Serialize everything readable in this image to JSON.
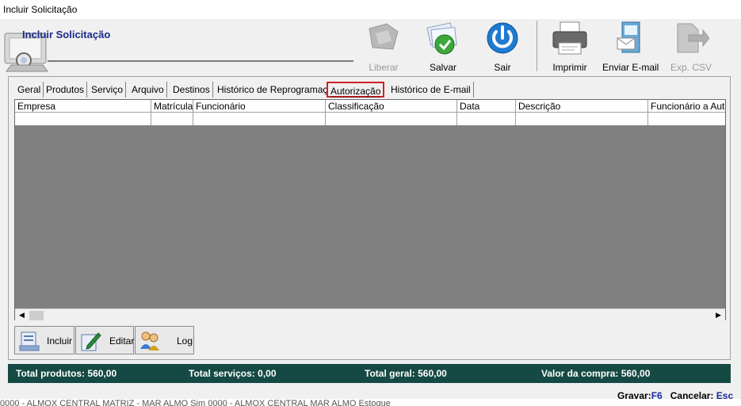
{
  "window": {
    "title": "Incluir Solicitação"
  },
  "header": {
    "title": "Incluir Solicitação"
  },
  "toolbar": {
    "liberar": "Liberar",
    "salvar": "Salvar",
    "sair": "Sair",
    "imprimir": "Imprimir",
    "enviar_email": "Enviar E-mail",
    "exp_csv": "Exp. CSV"
  },
  "tabs": [
    "Geral",
    "Produtos",
    "Serviço",
    "Arquivo",
    "Destinos",
    "Histórico de Reprogramação",
    "Autorização",
    "Histórico de E-mail"
  ],
  "active_tab": "Autorização",
  "grid": {
    "columns": [
      "Empresa",
      "Matrícula",
      "Funcionário",
      "Classificação",
      "Data",
      "Descrição",
      "Funcionário a Autoriz"
    ]
  },
  "actions": {
    "incluir": "Incluir",
    "editar": "Editar",
    "log": "Log"
  },
  "totals": {
    "produtos": "Total produtos: 560,00",
    "servicos": "Total serviços: 0,00",
    "geral": "Total geral: 560,00",
    "compra": "Valor da compra: 560,00"
  },
  "shortcuts": {
    "gravar_label": "Gravar:",
    "gravar_key": "F6",
    "cancelar_label": "Cancelar:",
    "cancelar_key": "Esc"
  },
  "background_text": "0000 - ALMOX CENTRAL MATRIZ - MAR ALMO Sim          0000 - ALMOX CENTRAL MAR ALMO Estoque",
  "colors": {
    "title_blue": "#1a2a8a",
    "totals_bar": "#154a44",
    "active_tab_border": "#d42020",
    "grid_empty": "#808080"
  }
}
